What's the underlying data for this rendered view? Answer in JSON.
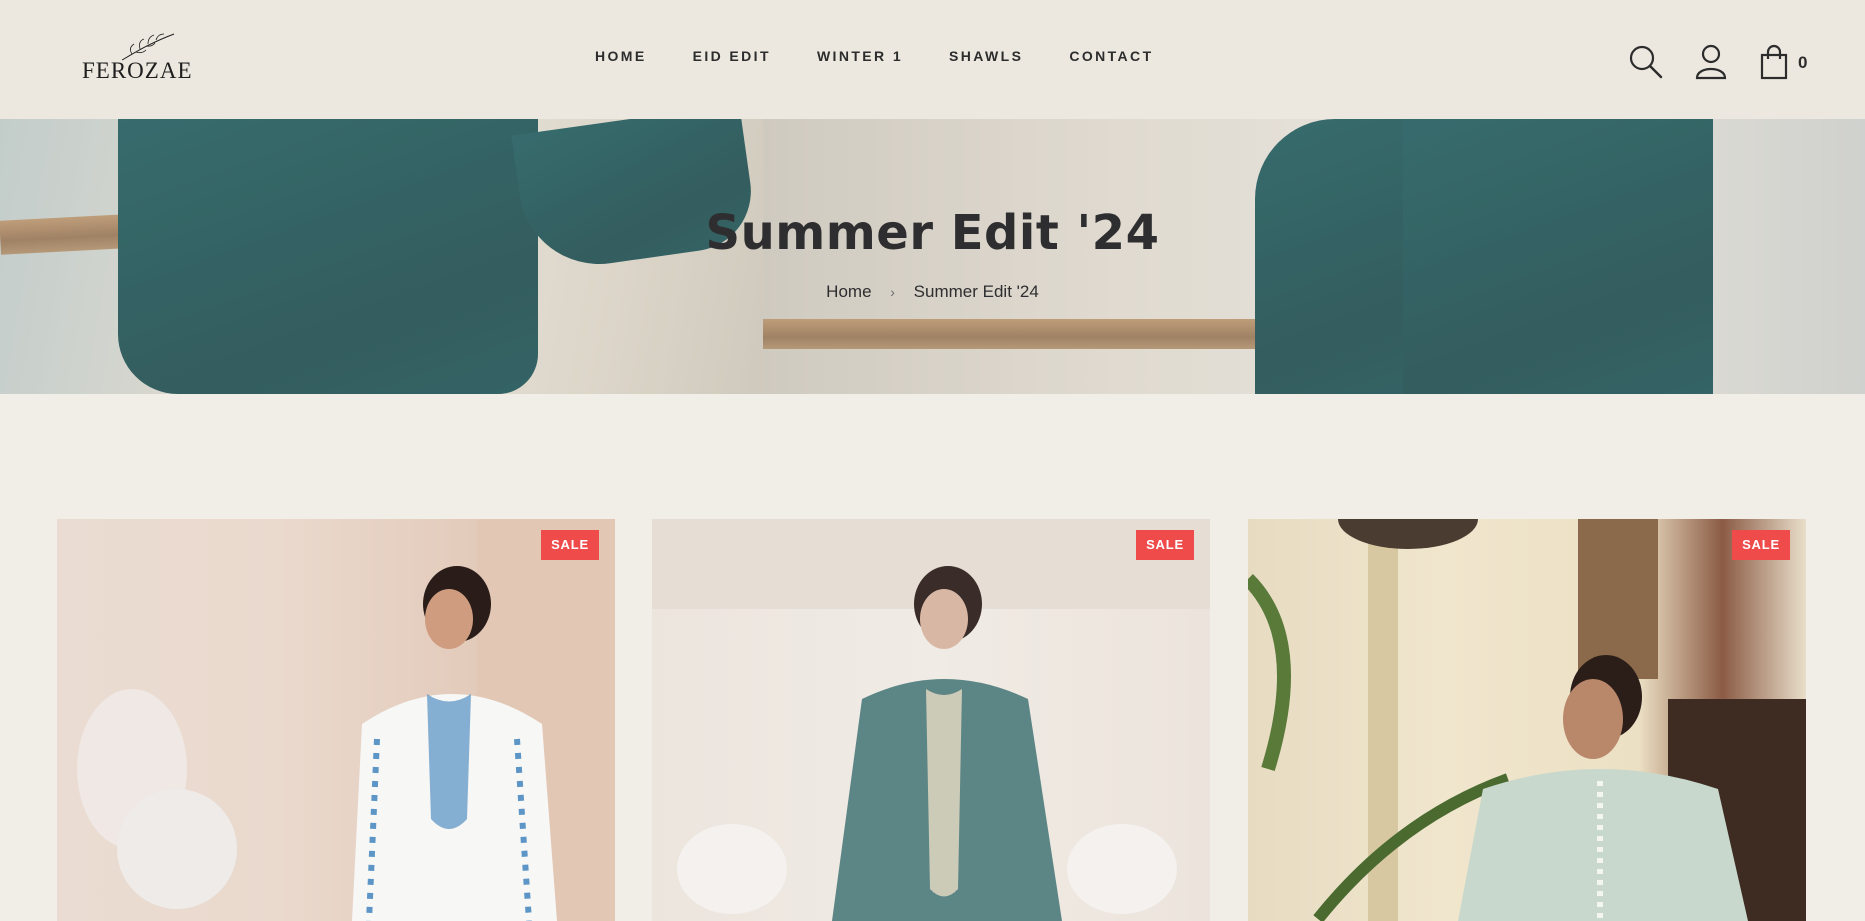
{
  "brand": {
    "name": "FEROZAE"
  },
  "nav": {
    "items": [
      {
        "label": "HOME"
      },
      {
        "label": "EID EDIT"
      },
      {
        "label": "WINTER 1"
      },
      {
        "label": "SHAWLS"
      },
      {
        "label": "CONTACT"
      }
    ]
  },
  "header_icons": {
    "search": "search-icon",
    "account": "user-icon",
    "cart": "shopping-bag-icon"
  },
  "cart": {
    "count": "0"
  },
  "hero": {
    "title": "Summer Edit '24",
    "breadcrumb": {
      "home": "Home",
      "current": "Summer Edit '24"
    }
  },
  "products": [
    {
      "badge": "SALE"
    },
    {
      "badge": "SALE"
    },
    {
      "badge": "SALE"
    }
  ],
  "colors": {
    "background": "#f1ede7",
    "header": "#ece8df",
    "sale_badge": "#ef4b4b",
    "text": "#2b2b2b"
  }
}
